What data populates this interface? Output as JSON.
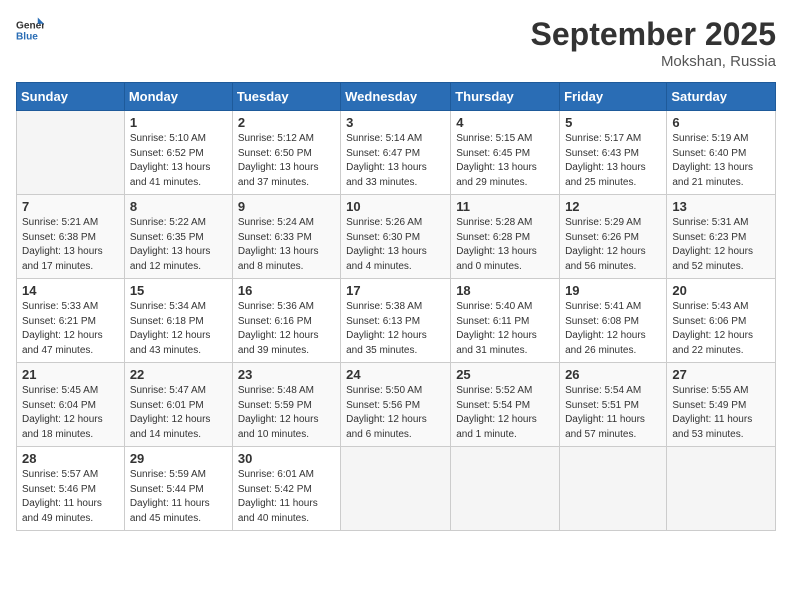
{
  "header": {
    "logo_general": "General",
    "logo_blue": "Blue",
    "month": "September 2025",
    "location": "Mokshan, Russia"
  },
  "days_of_week": [
    "Sunday",
    "Monday",
    "Tuesday",
    "Wednesday",
    "Thursday",
    "Friday",
    "Saturday"
  ],
  "weeks": [
    [
      {
        "day": "",
        "detail": ""
      },
      {
        "day": "1",
        "detail": "Sunrise: 5:10 AM\nSunset: 6:52 PM\nDaylight: 13 hours\nand 41 minutes."
      },
      {
        "day": "2",
        "detail": "Sunrise: 5:12 AM\nSunset: 6:50 PM\nDaylight: 13 hours\nand 37 minutes."
      },
      {
        "day": "3",
        "detail": "Sunrise: 5:14 AM\nSunset: 6:47 PM\nDaylight: 13 hours\nand 33 minutes."
      },
      {
        "day": "4",
        "detail": "Sunrise: 5:15 AM\nSunset: 6:45 PM\nDaylight: 13 hours\nand 29 minutes."
      },
      {
        "day": "5",
        "detail": "Sunrise: 5:17 AM\nSunset: 6:43 PM\nDaylight: 13 hours\nand 25 minutes."
      },
      {
        "day": "6",
        "detail": "Sunrise: 5:19 AM\nSunset: 6:40 PM\nDaylight: 13 hours\nand 21 minutes."
      }
    ],
    [
      {
        "day": "7",
        "detail": "Sunrise: 5:21 AM\nSunset: 6:38 PM\nDaylight: 13 hours\nand 17 minutes."
      },
      {
        "day": "8",
        "detail": "Sunrise: 5:22 AM\nSunset: 6:35 PM\nDaylight: 13 hours\nand 12 minutes."
      },
      {
        "day": "9",
        "detail": "Sunrise: 5:24 AM\nSunset: 6:33 PM\nDaylight: 13 hours\nand 8 minutes."
      },
      {
        "day": "10",
        "detail": "Sunrise: 5:26 AM\nSunset: 6:30 PM\nDaylight: 13 hours\nand 4 minutes."
      },
      {
        "day": "11",
        "detail": "Sunrise: 5:28 AM\nSunset: 6:28 PM\nDaylight: 13 hours\nand 0 minutes."
      },
      {
        "day": "12",
        "detail": "Sunrise: 5:29 AM\nSunset: 6:26 PM\nDaylight: 12 hours\nand 56 minutes."
      },
      {
        "day": "13",
        "detail": "Sunrise: 5:31 AM\nSunset: 6:23 PM\nDaylight: 12 hours\nand 52 minutes."
      }
    ],
    [
      {
        "day": "14",
        "detail": "Sunrise: 5:33 AM\nSunset: 6:21 PM\nDaylight: 12 hours\nand 47 minutes."
      },
      {
        "day": "15",
        "detail": "Sunrise: 5:34 AM\nSunset: 6:18 PM\nDaylight: 12 hours\nand 43 minutes."
      },
      {
        "day": "16",
        "detail": "Sunrise: 5:36 AM\nSunset: 6:16 PM\nDaylight: 12 hours\nand 39 minutes."
      },
      {
        "day": "17",
        "detail": "Sunrise: 5:38 AM\nSunset: 6:13 PM\nDaylight: 12 hours\nand 35 minutes."
      },
      {
        "day": "18",
        "detail": "Sunrise: 5:40 AM\nSunset: 6:11 PM\nDaylight: 12 hours\nand 31 minutes."
      },
      {
        "day": "19",
        "detail": "Sunrise: 5:41 AM\nSunset: 6:08 PM\nDaylight: 12 hours\nand 26 minutes."
      },
      {
        "day": "20",
        "detail": "Sunrise: 5:43 AM\nSunset: 6:06 PM\nDaylight: 12 hours\nand 22 minutes."
      }
    ],
    [
      {
        "day": "21",
        "detail": "Sunrise: 5:45 AM\nSunset: 6:04 PM\nDaylight: 12 hours\nand 18 minutes."
      },
      {
        "day": "22",
        "detail": "Sunrise: 5:47 AM\nSunset: 6:01 PM\nDaylight: 12 hours\nand 14 minutes."
      },
      {
        "day": "23",
        "detail": "Sunrise: 5:48 AM\nSunset: 5:59 PM\nDaylight: 12 hours\nand 10 minutes."
      },
      {
        "day": "24",
        "detail": "Sunrise: 5:50 AM\nSunset: 5:56 PM\nDaylight: 12 hours\nand 6 minutes."
      },
      {
        "day": "25",
        "detail": "Sunrise: 5:52 AM\nSunset: 5:54 PM\nDaylight: 12 hours\nand 1 minute."
      },
      {
        "day": "26",
        "detail": "Sunrise: 5:54 AM\nSunset: 5:51 PM\nDaylight: 11 hours\nand 57 minutes."
      },
      {
        "day": "27",
        "detail": "Sunrise: 5:55 AM\nSunset: 5:49 PM\nDaylight: 11 hours\nand 53 minutes."
      }
    ],
    [
      {
        "day": "28",
        "detail": "Sunrise: 5:57 AM\nSunset: 5:46 PM\nDaylight: 11 hours\nand 49 minutes."
      },
      {
        "day": "29",
        "detail": "Sunrise: 5:59 AM\nSunset: 5:44 PM\nDaylight: 11 hours\nand 45 minutes."
      },
      {
        "day": "30",
        "detail": "Sunrise: 6:01 AM\nSunset: 5:42 PM\nDaylight: 11 hours\nand 40 minutes."
      },
      {
        "day": "",
        "detail": ""
      },
      {
        "day": "",
        "detail": ""
      },
      {
        "day": "",
        "detail": ""
      },
      {
        "day": "",
        "detail": ""
      }
    ]
  ]
}
